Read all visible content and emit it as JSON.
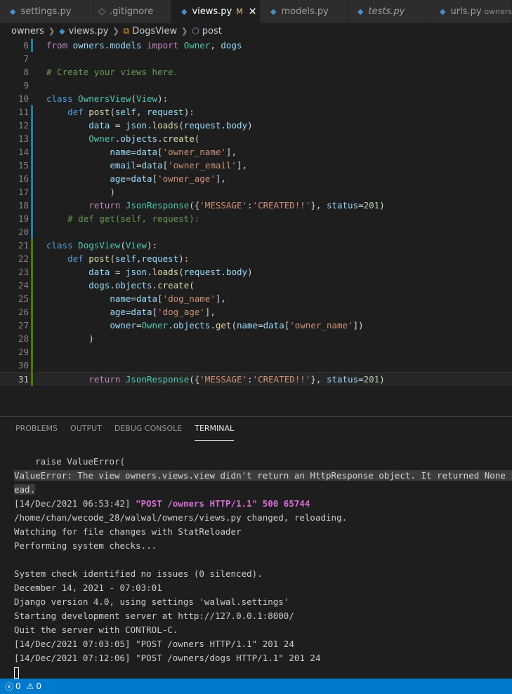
{
  "tabs": [
    {
      "label": "settings.py",
      "type": "py"
    },
    {
      "label": ".gitignore",
      "type": "git"
    },
    {
      "label": "views.py",
      "type": "py",
      "active": true,
      "modified": "M"
    },
    {
      "label": "models.py",
      "type": "py"
    },
    {
      "label": "tests.py",
      "type": "py",
      "italic": true
    },
    {
      "label": "urls.py",
      "type": "py",
      "description": "owners"
    }
  ],
  "breadcrumb": {
    "folder": "owners",
    "file": "views.py",
    "class": "DogsView",
    "method": "post"
  },
  "editor": {
    "lines": [
      {
        "n": "6",
        "code": "from owners.models import Owner, dogs"
      },
      {
        "n": "7",
        "code": ""
      },
      {
        "n": "8",
        "code": "# Create your views here."
      },
      {
        "n": "9",
        "code": ""
      },
      {
        "n": "10",
        "code": "class OwnersView(View):"
      },
      {
        "n": "11",
        "code": "    def post(self, request):"
      },
      {
        "n": "12",
        "code": "        data = json.loads(request.body)"
      },
      {
        "n": "13",
        "code": "        Owner.objects.create("
      },
      {
        "n": "14",
        "code": "            name=data['owner_name'],"
      },
      {
        "n": "15",
        "code": "            email=data['owner_email'],"
      },
      {
        "n": "16",
        "code": "            age=data['owner_age'],"
      },
      {
        "n": "17",
        "code": "            )"
      },
      {
        "n": "18",
        "code": "        return JsonResponse({'MESSAGE':'CREATED!!'}, status=201)"
      },
      {
        "n": "19",
        "code": "    # def get(self, request):"
      },
      {
        "n": "20",
        "code": ""
      },
      {
        "n": "21",
        "code": "class DogsView(View):"
      },
      {
        "n": "22",
        "code": "    def post(self,request):"
      },
      {
        "n": "23",
        "code": "        data = json.loads(request.body)"
      },
      {
        "n": "24",
        "code": "        dogs.objects.create("
      },
      {
        "n": "25",
        "code": "            name=data['dog_name'],"
      },
      {
        "n": "26",
        "code": "            age=data['dog_age'],"
      },
      {
        "n": "27",
        "code": "            owner=Owner.objects.get(name=data['owner_name'])"
      },
      {
        "n": "28",
        "code": "        )"
      },
      {
        "n": "29",
        "code": ""
      },
      {
        "n": "30",
        "code": ""
      },
      {
        "n": "31",
        "code": "        return JsonResponse({'MESSAGE':'CREATED!!'}, status=201)"
      }
    ]
  },
  "panel": {
    "tabs": [
      "PROBLEMS",
      "OUTPUT",
      "DEBUG CONSOLE",
      "TERMINAL"
    ],
    "active_tab": "TERMINAL",
    "terminal": [
      "    raise ValueError(",
      "ValueError: The view owners.views.view didn't return an HttpResponse object. It returned None inst",
      "ead.",
      "[14/Dec/2021 06:53:42] ",
      "\"POST /owners HTTP/1.1\" 500 65744",
      "/home/chan/wecode_28/walwal/owners/views.py changed, reloading.",
      "Watching for file changes with StatReloader",
      "Performing system checks...",
      "",
      "System check identified no issues (0 silenced).",
      "December 14, 2021 - 07:03:01",
      "Django version 4.0, using settings 'walwal.settings'",
      "Starting development server at http://127.0.0.1:8000/",
      "Quit the server with CONTROL-C.",
      "[14/Dec/2021 07:03:05] \"POST /owners HTTP/1.1\" 201 24",
      "[14/Dec/2021 07:12:06] \"POST /owners/dogs HTTP/1.1\" 201 24"
    ]
  },
  "status": {
    "errors": "0",
    "warnings": "0"
  },
  "colors": {
    "accent": "#007acc",
    "editor_bg": "#1e1e1e"
  }
}
